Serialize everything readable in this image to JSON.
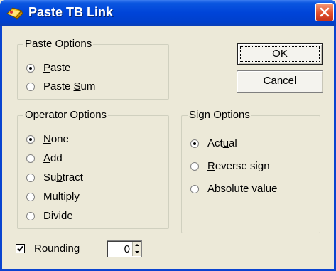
{
  "window": {
    "title": "Paste TB Link"
  },
  "paste_options": {
    "legend": "Paste Options",
    "options": [
      {
        "label_pre": "",
        "accel": "P",
        "label_post": "aste",
        "checked": true
      },
      {
        "label_pre": "Paste ",
        "accel": "S",
        "label_post": "um",
        "checked": false
      }
    ]
  },
  "operator_options": {
    "legend": "Operator Options",
    "options": [
      {
        "label_pre": "",
        "accel": "N",
        "label_post": "one",
        "checked": true
      },
      {
        "label_pre": "",
        "accel": "A",
        "label_post": "dd",
        "checked": false
      },
      {
        "label_pre": "Su",
        "accel": "b",
        "label_post": "tract",
        "checked": false
      },
      {
        "label_pre": "",
        "accel": "M",
        "label_post": "ultiply",
        "checked": false
      },
      {
        "label_pre": "",
        "accel": "D",
        "label_post": "ivide",
        "checked": false
      }
    ]
  },
  "sign_options": {
    "legend": "Sign Options",
    "options": [
      {
        "label_pre": "Act",
        "accel": "u",
        "label_post": "al",
        "checked": true
      },
      {
        "label_pre": "",
        "accel": "R",
        "label_post": "everse sign",
        "checked": false
      },
      {
        "label_pre": "Absolute ",
        "accel": "v",
        "label_post": "alue",
        "checked": false
      }
    ]
  },
  "buttons": {
    "ok": {
      "label_pre": "",
      "accel": "O",
      "label_post": "K"
    },
    "cancel": {
      "label_pre": "",
      "accel": "C",
      "label_post": "ancel"
    }
  },
  "rounding": {
    "label_pre": "",
    "accel": "R",
    "label_post": "ounding",
    "checked": true,
    "value": "0"
  },
  "colors": {
    "title_bar": "#0044d8",
    "dialog_bg": "#ece9d8",
    "close_button": "#e1502d"
  },
  "icons": [
    "app-icon",
    "close-icon",
    "radio-icon",
    "checkmark-icon",
    "spin-up-icon",
    "spin-down-icon"
  ]
}
